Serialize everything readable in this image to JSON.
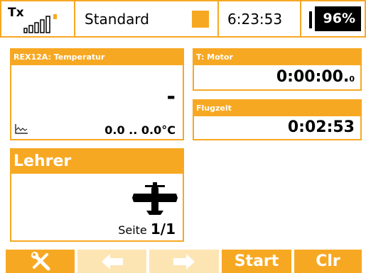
{
  "status": {
    "tx_label": "Tx",
    "model_name": "Standard",
    "clock": "6:23:53",
    "battery": "96%"
  },
  "widgets": {
    "temperature": {
      "title": "REX12A: Temperatur",
      "current": "-",
      "range": "0.0 .. 0.0°C"
    },
    "motor_timer": {
      "title": "T: Motor",
      "value_main": "0:00:00.",
      "value_tenth": "0"
    },
    "flight_time": {
      "title": "Flugzeit",
      "value": "0:02:53"
    },
    "trainer": {
      "title": "Lehrer",
      "page_label": "Seite",
      "page_value": "1/1"
    }
  },
  "bottom_buttons": {
    "tools_icon": "wrench-screwdriver",
    "left_icon": "arrow-left",
    "right_icon": "arrow-right",
    "start_label": "Start",
    "clear_label": "Clr"
  },
  "colors": {
    "accent": "#f7a823",
    "accent_light": "#fde5b3",
    "battery_bg": "#000000"
  }
}
